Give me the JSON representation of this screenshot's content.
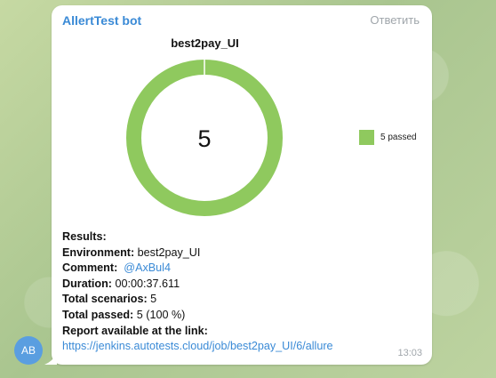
{
  "chat": {
    "sender_name": "AllertTest bot",
    "reply_label": "Ответить",
    "time": "13:03",
    "avatar_initials": "AB"
  },
  "chart_data": {
    "type": "pie",
    "title": "best2pay_UI",
    "center_label": "5",
    "slices": [
      {
        "label": "5 passed",
        "value": 5,
        "color": "#8fc95e"
      }
    ]
  },
  "report": {
    "results_label": "Results:",
    "environment_label": "Environment:",
    "environment_value": "best2pay_UI",
    "comment_label": "Comment:",
    "comment_value": "@AxBul4",
    "duration_label": "Duration:",
    "duration_value": "00:00:37.611",
    "scenarios_label": "Total scenarios:",
    "scenarios_value": "5",
    "passed_label": "Total passed:",
    "passed_value": "5 (100 %)",
    "link_label": "Report available at the link:",
    "link_url": "https://jenkins.autotests.cloud/job/best2pay_UI/6/allure"
  }
}
